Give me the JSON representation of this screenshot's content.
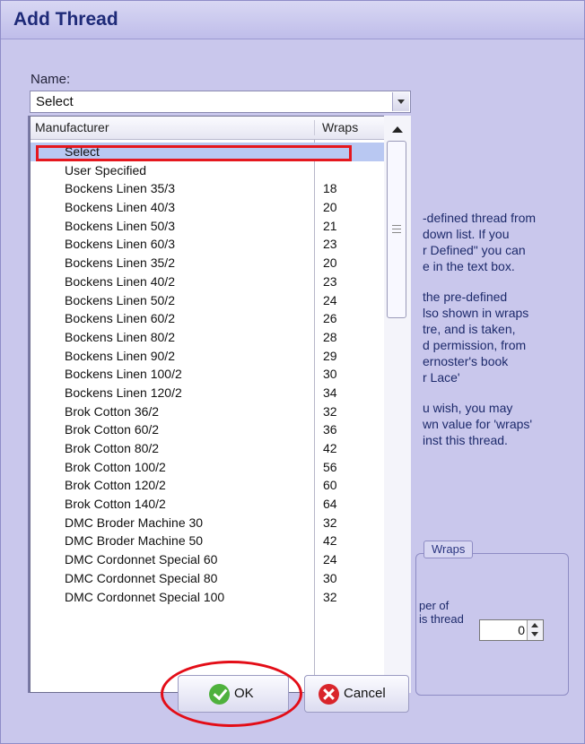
{
  "dialog": {
    "title": "Add Thread"
  },
  "name_field": {
    "label": "Name:",
    "value": "Select"
  },
  "list": {
    "headers": {
      "manufacturer": "Manufacturer",
      "wraps": "Wraps"
    },
    "rows": [
      {
        "manufacturer": "Select",
        "wraps": ""
      },
      {
        "manufacturer": "User Specified",
        "wraps": ""
      },
      {
        "manufacturer": "Bockens Linen 35/3",
        "wraps": "18"
      },
      {
        "manufacturer": "Bockens Linen 40/3",
        "wraps": "20"
      },
      {
        "manufacturer": "Bockens Linen 50/3",
        "wraps": "21"
      },
      {
        "manufacturer": "Bockens Linen 60/3",
        "wraps": "23"
      },
      {
        "manufacturer": "Bockens Linen 35/2",
        "wraps": "20"
      },
      {
        "manufacturer": "Bockens Linen 40/2",
        "wraps": "23"
      },
      {
        "manufacturer": "Bockens Linen 50/2",
        "wraps": "24"
      },
      {
        "manufacturer": "Bockens Linen 60/2",
        "wraps": "26"
      },
      {
        "manufacturer": "Bockens Linen 80/2",
        "wraps": "28"
      },
      {
        "manufacturer": "Bockens Linen 90/2",
        "wraps": "29"
      },
      {
        "manufacturer": "Bockens Linen 100/2",
        "wraps": "30"
      },
      {
        "manufacturer": "Bockens Linen 120/2",
        "wraps": "34"
      },
      {
        "manufacturer": "Brok Cotton 36/2",
        "wraps": "32"
      },
      {
        "manufacturer": "Brok Cotton 60/2",
        "wraps": "36"
      },
      {
        "manufacturer": "Brok Cotton 80/2",
        "wraps": "42"
      },
      {
        "manufacturer": "Brok Cotton 100/2",
        "wraps": "56"
      },
      {
        "manufacturer": "Brok Cotton 120/2",
        "wraps": "60"
      },
      {
        "manufacturer": "Brok Cotton 140/2",
        "wraps": "64"
      },
      {
        "manufacturer": "DMC Broder Machine 30",
        "wraps": "32"
      },
      {
        "manufacturer": "DMC Broder Machine 50",
        "wraps": "42"
      },
      {
        "manufacturer": "DMC Cordonnet Special 60",
        "wraps": "24"
      },
      {
        "manufacturer": "DMC Cordonnet Special 80",
        "wraps": "30"
      },
      {
        "manufacturer": "DMC Cordonnet Special 100",
        "wraps": "32"
      }
    ]
  },
  "info_text": {
    "p1": "-defined thread from\ndown list. If you\nr Defined\" you can\ne in the text box.",
    "p2": "the pre-defined\nlso shown in wraps\ntre, and is taken,\nd permission, from\nernoster's book\nr Lace'",
    "p3": "u wish, you may\nwn value for 'wraps'\ninst this thread."
  },
  "wraps_group": {
    "legend": "Wraps",
    "label": "per of\nis thread",
    "value": "0"
  },
  "buttons": {
    "ok": "OK",
    "cancel": "Cancel"
  },
  "icons": {
    "ok": "check-circle-icon",
    "cancel": "x-circle-icon"
  },
  "colors": {
    "accent": "#e5171e",
    "ok": "#4eb13d",
    "cancel": "#d9252b",
    "title": "#1e2a78"
  }
}
